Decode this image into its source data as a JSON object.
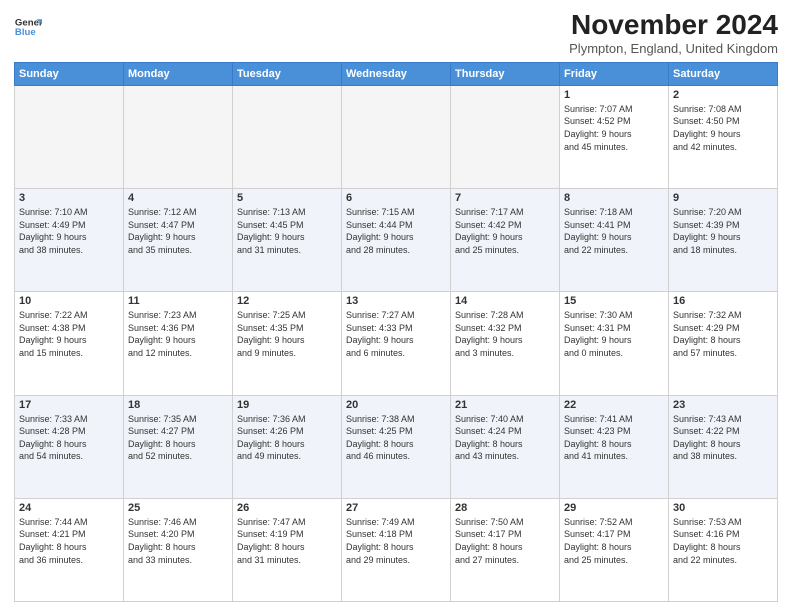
{
  "header": {
    "logo": {
      "line1": "General",
      "line2": "Blue"
    },
    "title": "November 2024",
    "location": "Plympton, England, United Kingdom"
  },
  "weekdays": [
    "Sunday",
    "Monday",
    "Tuesday",
    "Wednesday",
    "Thursday",
    "Friday",
    "Saturday"
  ],
  "weeks": [
    [
      {
        "day": "",
        "info": ""
      },
      {
        "day": "",
        "info": ""
      },
      {
        "day": "",
        "info": ""
      },
      {
        "day": "",
        "info": ""
      },
      {
        "day": "",
        "info": ""
      },
      {
        "day": "1",
        "info": "Sunrise: 7:07 AM\nSunset: 4:52 PM\nDaylight: 9 hours\nand 45 minutes."
      },
      {
        "day": "2",
        "info": "Sunrise: 7:08 AM\nSunset: 4:50 PM\nDaylight: 9 hours\nand 42 minutes."
      }
    ],
    [
      {
        "day": "3",
        "info": "Sunrise: 7:10 AM\nSunset: 4:49 PM\nDaylight: 9 hours\nand 38 minutes."
      },
      {
        "day": "4",
        "info": "Sunrise: 7:12 AM\nSunset: 4:47 PM\nDaylight: 9 hours\nand 35 minutes."
      },
      {
        "day": "5",
        "info": "Sunrise: 7:13 AM\nSunset: 4:45 PM\nDaylight: 9 hours\nand 31 minutes."
      },
      {
        "day": "6",
        "info": "Sunrise: 7:15 AM\nSunset: 4:44 PM\nDaylight: 9 hours\nand 28 minutes."
      },
      {
        "day": "7",
        "info": "Sunrise: 7:17 AM\nSunset: 4:42 PM\nDaylight: 9 hours\nand 25 minutes."
      },
      {
        "day": "8",
        "info": "Sunrise: 7:18 AM\nSunset: 4:41 PM\nDaylight: 9 hours\nand 22 minutes."
      },
      {
        "day": "9",
        "info": "Sunrise: 7:20 AM\nSunset: 4:39 PM\nDaylight: 9 hours\nand 18 minutes."
      }
    ],
    [
      {
        "day": "10",
        "info": "Sunrise: 7:22 AM\nSunset: 4:38 PM\nDaylight: 9 hours\nand 15 minutes."
      },
      {
        "day": "11",
        "info": "Sunrise: 7:23 AM\nSunset: 4:36 PM\nDaylight: 9 hours\nand 12 minutes."
      },
      {
        "day": "12",
        "info": "Sunrise: 7:25 AM\nSunset: 4:35 PM\nDaylight: 9 hours\nand 9 minutes."
      },
      {
        "day": "13",
        "info": "Sunrise: 7:27 AM\nSunset: 4:33 PM\nDaylight: 9 hours\nand 6 minutes."
      },
      {
        "day": "14",
        "info": "Sunrise: 7:28 AM\nSunset: 4:32 PM\nDaylight: 9 hours\nand 3 minutes."
      },
      {
        "day": "15",
        "info": "Sunrise: 7:30 AM\nSunset: 4:31 PM\nDaylight: 9 hours\nand 0 minutes."
      },
      {
        "day": "16",
        "info": "Sunrise: 7:32 AM\nSunset: 4:29 PM\nDaylight: 8 hours\nand 57 minutes."
      }
    ],
    [
      {
        "day": "17",
        "info": "Sunrise: 7:33 AM\nSunset: 4:28 PM\nDaylight: 8 hours\nand 54 minutes."
      },
      {
        "day": "18",
        "info": "Sunrise: 7:35 AM\nSunset: 4:27 PM\nDaylight: 8 hours\nand 52 minutes."
      },
      {
        "day": "19",
        "info": "Sunrise: 7:36 AM\nSunset: 4:26 PM\nDaylight: 8 hours\nand 49 minutes."
      },
      {
        "day": "20",
        "info": "Sunrise: 7:38 AM\nSunset: 4:25 PM\nDaylight: 8 hours\nand 46 minutes."
      },
      {
        "day": "21",
        "info": "Sunrise: 7:40 AM\nSunset: 4:24 PM\nDaylight: 8 hours\nand 43 minutes."
      },
      {
        "day": "22",
        "info": "Sunrise: 7:41 AM\nSunset: 4:23 PM\nDaylight: 8 hours\nand 41 minutes."
      },
      {
        "day": "23",
        "info": "Sunrise: 7:43 AM\nSunset: 4:22 PM\nDaylight: 8 hours\nand 38 minutes."
      }
    ],
    [
      {
        "day": "24",
        "info": "Sunrise: 7:44 AM\nSunset: 4:21 PM\nDaylight: 8 hours\nand 36 minutes."
      },
      {
        "day": "25",
        "info": "Sunrise: 7:46 AM\nSunset: 4:20 PM\nDaylight: 8 hours\nand 33 minutes."
      },
      {
        "day": "26",
        "info": "Sunrise: 7:47 AM\nSunset: 4:19 PM\nDaylight: 8 hours\nand 31 minutes."
      },
      {
        "day": "27",
        "info": "Sunrise: 7:49 AM\nSunset: 4:18 PM\nDaylight: 8 hours\nand 29 minutes."
      },
      {
        "day": "28",
        "info": "Sunrise: 7:50 AM\nSunset: 4:17 PM\nDaylight: 8 hours\nand 27 minutes."
      },
      {
        "day": "29",
        "info": "Sunrise: 7:52 AM\nSunset: 4:17 PM\nDaylight: 8 hours\nand 25 minutes."
      },
      {
        "day": "30",
        "info": "Sunrise: 7:53 AM\nSunset: 4:16 PM\nDaylight: 8 hours\nand 22 minutes."
      }
    ]
  ]
}
